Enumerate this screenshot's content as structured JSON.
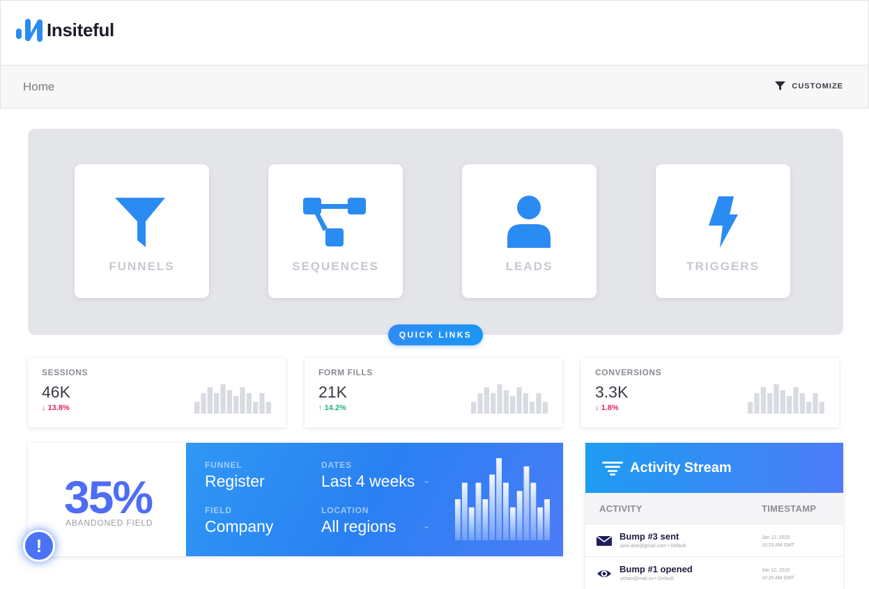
{
  "app": {
    "name": "Insiteful",
    "brand_color": "#2a8bf2"
  },
  "breadcrumb": {
    "current": "Home"
  },
  "toolbar": {
    "customize_label": "CUSTOMIZE",
    "customize_icon": "filter-icon"
  },
  "quick_links": {
    "pill_label": "QUICK LINKS",
    "items": [
      {
        "label": "FUNNELS",
        "icon": "funnel-icon"
      },
      {
        "label": "SEQUENCES",
        "icon": "sequence-icon"
      },
      {
        "label": "LEADS",
        "icon": "user-icon"
      },
      {
        "label": "TRIGGERS",
        "icon": "lightning-icon"
      }
    ]
  },
  "stats": [
    {
      "label": "SESSIONS",
      "value": "46K",
      "change": "13.8%",
      "direction": "down",
      "arrow": "↓",
      "spark": [
        4,
        7,
        9,
        7,
        10,
        8,
        6,
        9,
        7,
        4,
        7,
        4
      ]
    },
    {
      "label": "FORM FILLS",
      "value": "21K",
      "change": "14.2%",
      "direction": "up",
      "arrow": "↑",
      "spark": [
        4,
        7,
        9,
        7,
        10,
        8,
        6,
        9,
        7,
        4,
        7,
        4
      ]
    },
    {
      "label": "CONVERSIONS",
      "value": "3.3K",
      "change": "1.8%",
      "direction": "down",
      "arrow": "↓",
      "spark": [
        4,
        7,
        9,
        7,
        10,
        8,
        6,
        9,
        7,
        4,
        7,
        4
      ]
    }
  ],
  "abandon": {
    "percent": "35%",
    "subtitle": "ABANDONED FIELD",
    "funnel_label": "FUNNEL",
    "funnel_value": "Register",
    "dates_label": "DATES",
    "dates_value": "Last 4 weeks",
    "field_label": "FIELD",
    "field_value": "Company",
    "location_label": "LOCATION",
    "location_value": "All regions",
    "bars": [
      5,
      7,
      4,
      7,
      5,
      8,
      10,
      7,
      4,
      6,
      9,
      7,
      4,
      5
    ]
  },
  "activity": {
    "title": "Activity Stream",
    "col_activity": "ACTIVITY",
    "col_timestamp": "TIMESTAMP",
    "rows": [
      {
        "title": "Bump #3 sent",
        "sub": "jane.doe@gmail.com • Default",
        "time1": "Jan 12, 2020",
        "time2": "10:25 AM GMT",
        "icon": "envelope-icon"
      },
      {
        "title": "Bump #1 opened",
        "sub": "ychan@mail.co • Default",
        "time1": "Jan 12, 2020",
        "time2": "10:25 AM GMT",
        "icon": "eye-icon"
      }
    ]
  },
  "alert": {
    "symbol": "!"
  }
}
